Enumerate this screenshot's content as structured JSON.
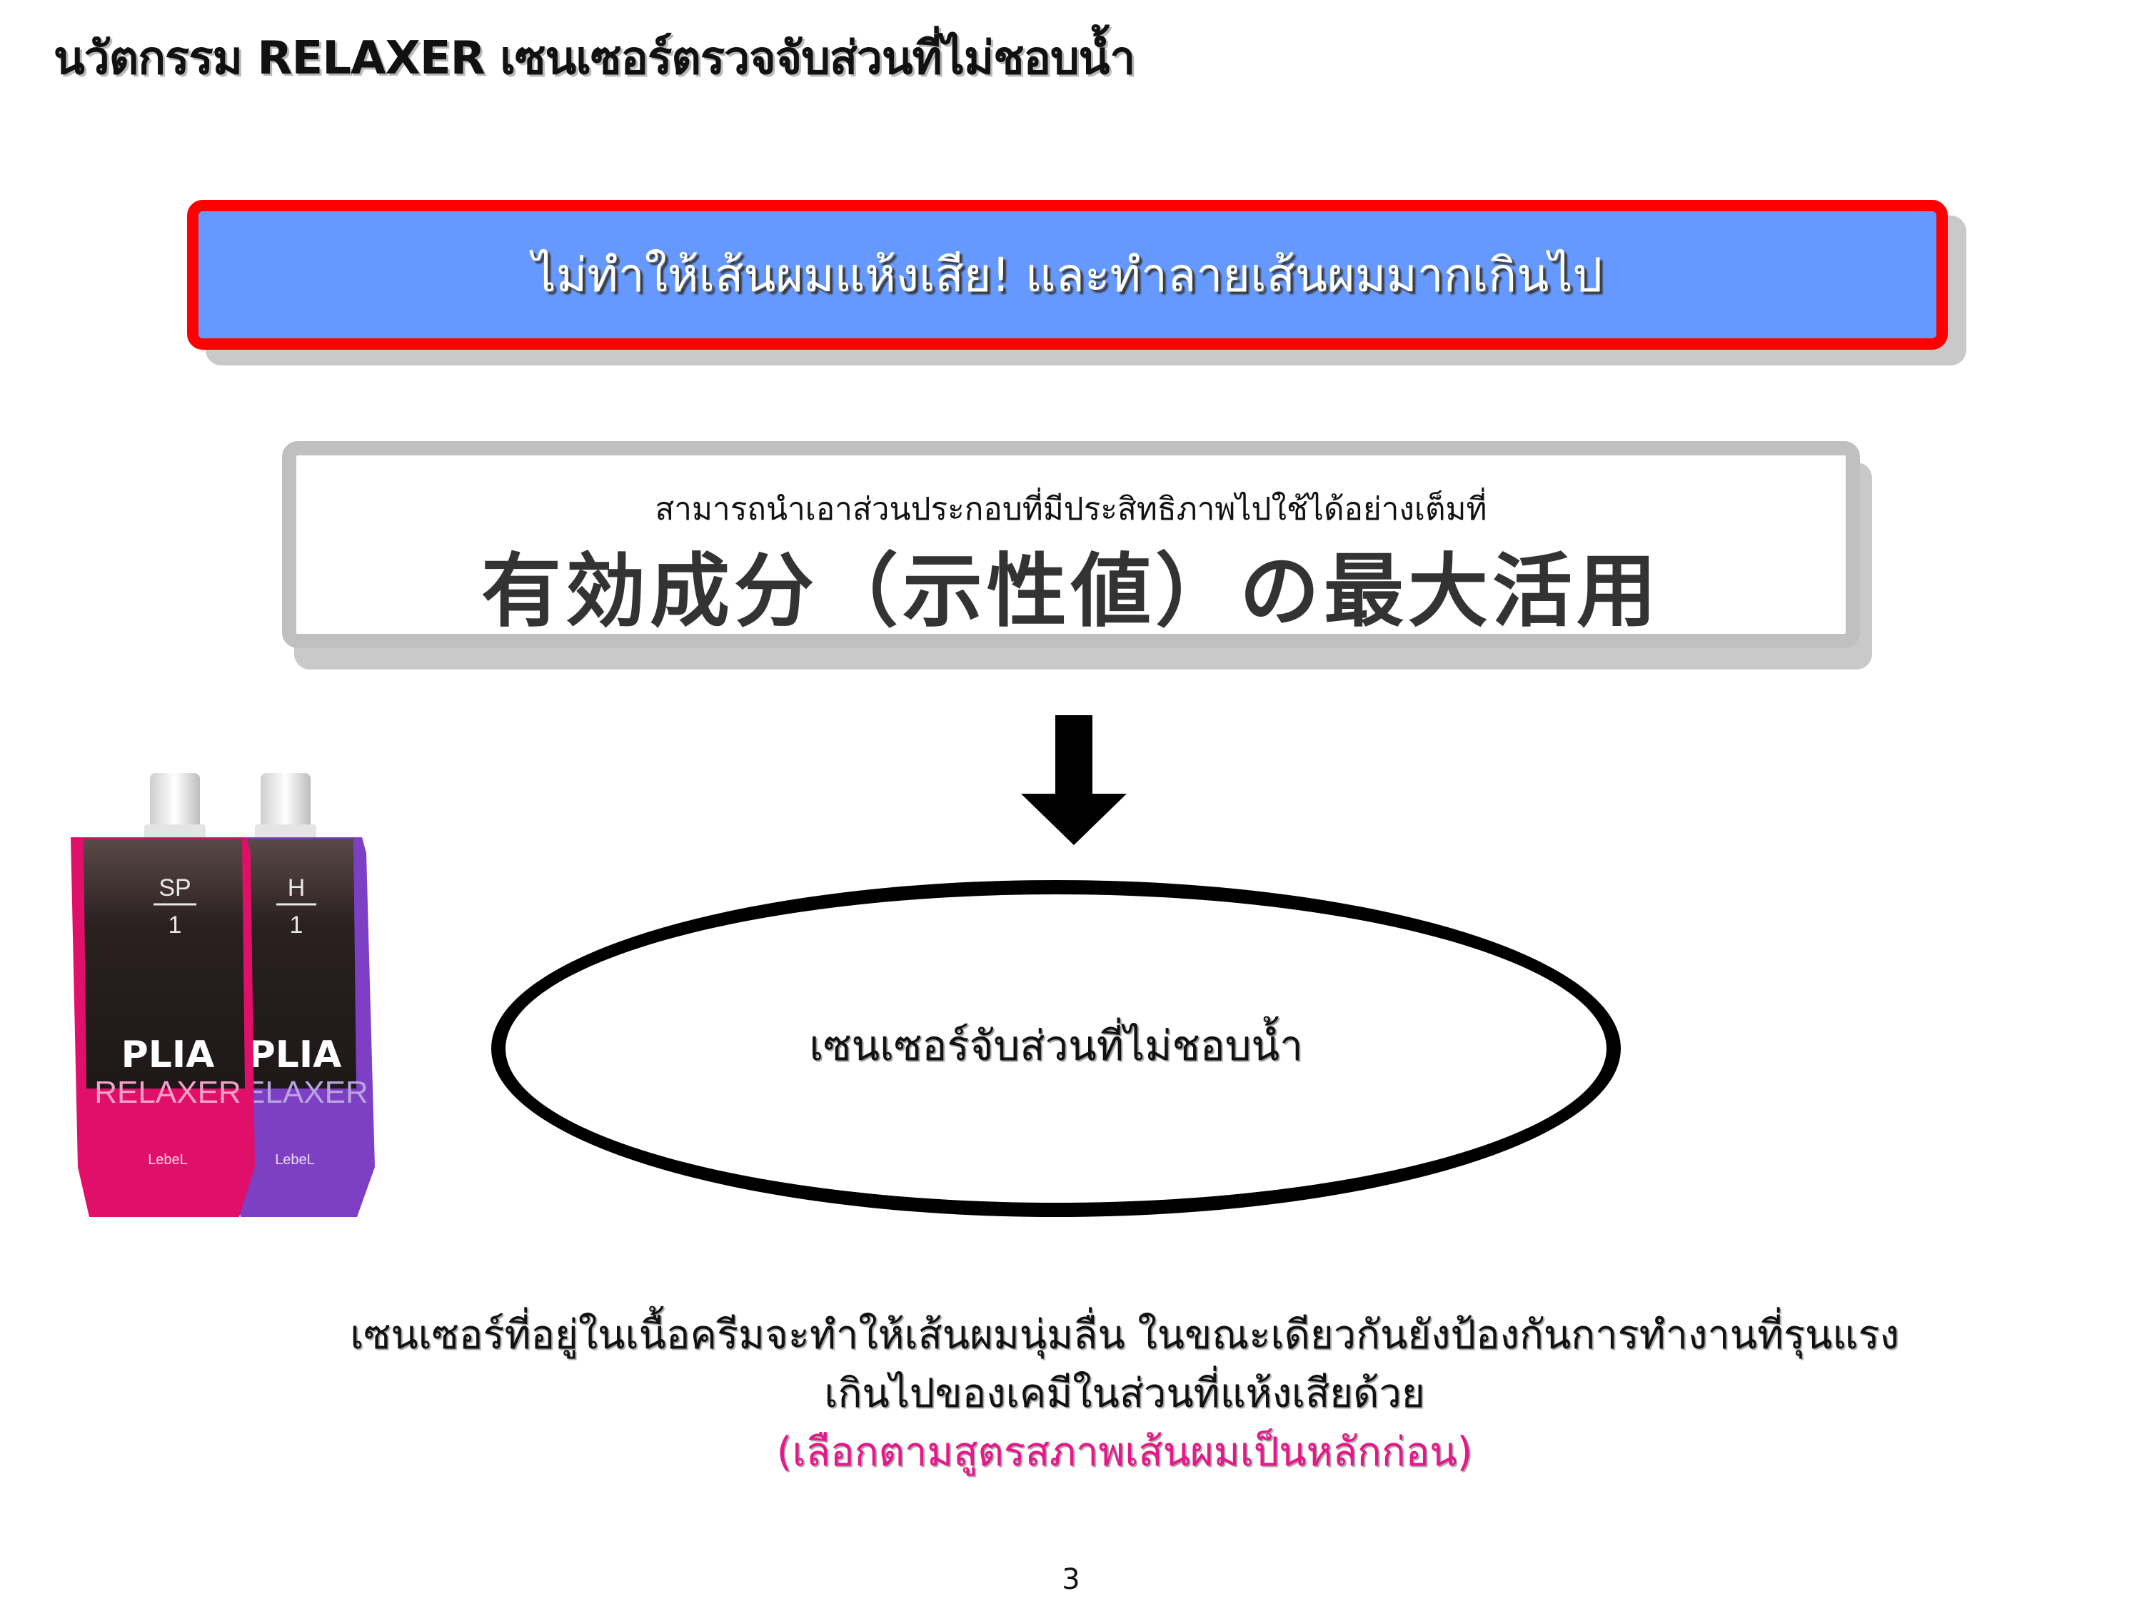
{
  "title": "นวัตกรรม RELAXER เซนเซอร์ตรวจจับส่วนที่ไม่ชอบน้ำ",
  "headline": "ไม่ทำให้เส้นผมแห้งเสีย! และทำลายเส้นผมมากเกินไป",
  "concept": {
    "subtitle": "สามารถนำเอาส่วนประกอบที่มีประสิทธิภาพไปใช้ได้อย่างเต็มที่",
    "main_text": "有効成分（示性値）の最大活用"
  },
  "sensor_label": "เซนเซอร์จับส่วนที่ไม่ชอบน้ำ",
  "products": [
    {
      "code": "SP",
      "number": "1",
      "brand": "PLIA",
      "line": "RELAXER",
      "maker": "LebeL",
      "color": "#e0106a"
    },
    {
      "code": "H",
      "number": "1",
      "brand": "PLIA",
      "line": "RELAXER",
      "maker": "LebeL",
      "color": "#7d3fc4"
    }
  ],
  "body": {
    "line1": "เซนเซอร์ที่อยู่ในเนื้อครีมจะทำให้เส้นผมนุ่มลื่น ในขณะเดียวกันยังป้องกันการทำงานที่รุนแรง",
    "line2": "เกินไปของเคมีในส่วนที่แห้งเสียด้วย",
    "note": "(เลือกตามสูตรสภาพเส้นผมเป็นหลักก่อน)"
  },
  "page_number": "3",
  "colors": {
    "headline_fill": "#6699ff",
    "headline_border": "#ff0000",
    "concept_border": "#c0c0c0",
    "note_color": "#e6178a"
  }
}
